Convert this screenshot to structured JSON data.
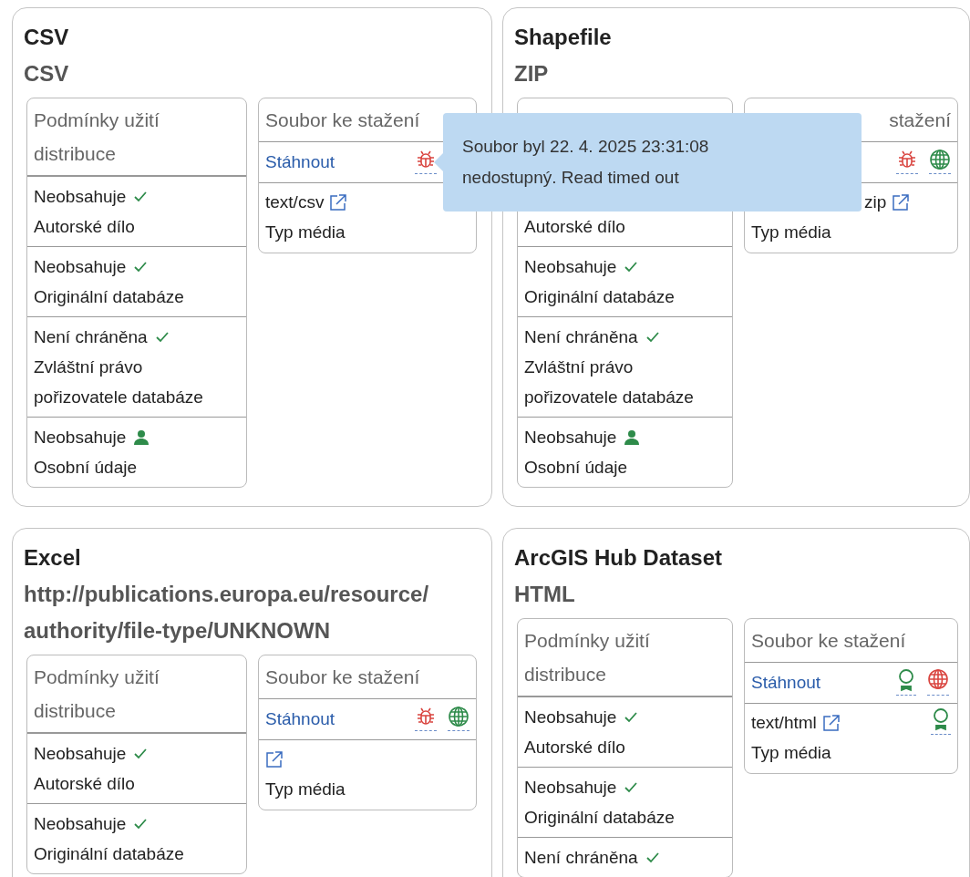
{
  "cards": [
    {
      "title": "CSV",
      "format": "CSV",
      "conditions": {
        "heading": "Podmínky užití distribuce",
        "rows": [
          {
            "value": "Neobsahuje",
            "kind": "check",
            "label": "Autorské dílo"
          },
          {
            "value": "Neobsahuje",
            "kind": "check",
            "label": "Originální databáze"
          },
          {
            "value": "Není chráněna",
            "kind": "check",
            "label": "Zvláštní právo pořizovatele databáze"
          },
          {
            "value": "Neobsahuje",
            "kind": "person",
            "label": "Osobní údaje"
          }
        ]
      },
      "download": {
        "heading": "Soubor ke stažení",
        "link": "Stáhnout",
        "icons": [
          {
            "kind": "bug",
            "color": "#d9443f"
          }
        ],
        "media_type": "text/csv",
        "partly_hidden": false,
        "media_label": "Typ média"
      }
    },
    {
      "title": "Shapefile",
      "format": "ZIP",
      "conditions": {
        "rows": [
          {
            "label": "Autorské dílo"
          },
          {
            "value": "Neobsahuje",
            "kind": "check",
            "label": "Originální databáze"
          },
          {
            "value": "Není chráněna",
            "kind": "check",
            "label": "Zvláštní právo pořizovatele databáze"
          },
          {
            "value": "Neobsahuje",
            "kind": "person",
            "label": "Osobní údaje"
          }
        ]
      },
      "download": {
        "heading": "stažení",
        "icons": [
          {
            "kind": "bug",
            "color": "#d9443f"
          },
          {
            "kind": "globe",
            "color": "#2e8b4a"
          }
        ],
        "media_type": "zip",
        "partly_hidden": true,
        "media_label": "Typ média"
      }
    },
    {
      "title": "Excel",
      "format": "http://publications.europa.eu/resource/authority/file-type/UNKNOWN",
      "conditions": {
        "heading": "Podmínky užití distribuce",
        "rows": [
          {
            "value": "Neobsahuje",
            "kind": "check",
            "label": "Autorské dílo"
          },
          {
            "value": "Neobsahuje",
            "kind": "check",
            "label": "Originální databáze"
          }
        ]
      },
      "download": {
        "heading": "Soubor ke stažení",
        "link": "Stáhnout",
        "icons": [
          {
            "kind": "bug",
            "color": "#d9443f"
          },
          {
            "kind": "globe",
            "color": "#2e8b4a"
          }
        ],
        "partly_hidden": false,
        "media_label": "Typ média"
      }
    },
    {
      "title": "ArcGIS Hub Dataset",
      "format": "HTML",
      "conditions": {
        "heading": "Podmínky užití distribuce",
        "rows": [
          {
            "value": "Neobsahuje",
            "kind": "check",
            "label": "Autorské dílo"
          },
          {
            "value": "Neobsahuje",
            "kind": "check",
            "label": "Originální databáze"
          },
          {
            "value": "Není chráněna",
            "kind": "check"
          }
        ]
      },
      "download": {
        "heading": "Soubor ke stažení",
        "link": "Stáhnout",
        "icons": [
          {
            "kind": "award",
            "color": "#2e8b4a"
          },
          {
            "kind": "globe",
            "color": "#d9443f"
          }
        ],
        "media_type": "text/html",
        "partly_hidden": false,
        "media_label": "Typ média",
        "media_icons": [
          {
            "kind": "award",
            "color": "#2e8b4a"
          }
        ]
      }
    }
  ],
  "tooltip": {
    "text": "Soubor byl 22. 4. 2025 23:31:08 nedostupný. Read timed out"
  }
}
